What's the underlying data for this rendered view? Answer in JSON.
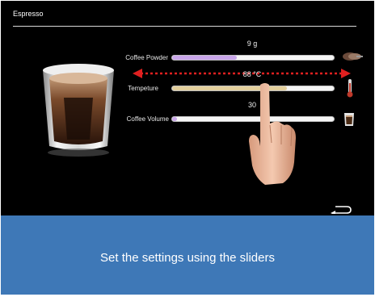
{
  "screen": {
    "title": "Espresso",
    "sliders": [
      {
        "label": "Coffee Powder",
        "value_text": "9 g",
        "level": 0.4,
        "fill_color": "#c9a6ea",
        "icon": "coffee-bean-icon"
      },
      {
        "label": "Tempeture",
        "value_text": "88 °C",
        "level": 0.71,
        "fill_color": "#e3cf9c",
        "icon": "thermometer-icon"
      },
      {
        "label": "Coffee Volume",
        "value_text": "30",
        "level": 0.03,
        "fill_color": "#c9a6ea",
        "icon": "coffee-cup-icon"
      }
    ],
    "back_icon": "return-arrow-icon"
  },
  "banner": {
    "text": "Set the settings using the sliders",
    "color": "#3e78b7"
  },
  "colors": {
    "arrow": "#e02020",
    "background": "#000000"
  }
}
